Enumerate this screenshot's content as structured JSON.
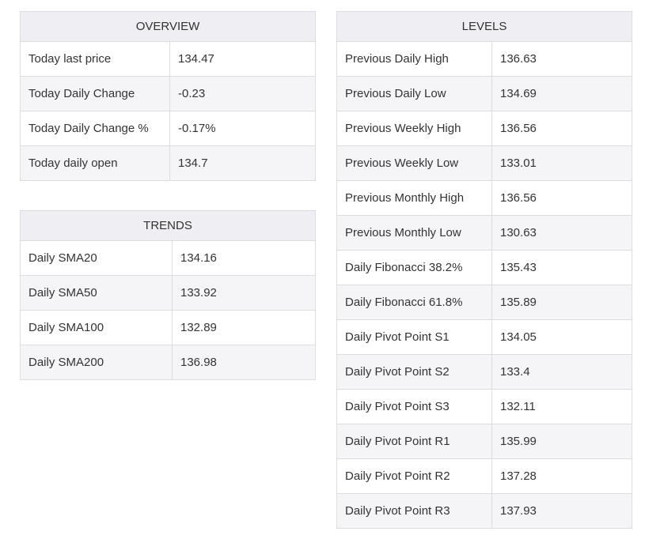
{
  "overview": {
    "title": "OVERVIEW",
    "rows": [
      {
        "label": "Today last price",
        "value": "134.47"
      },
      {
        "label": "Today Daily Change",
        "value": "-0.23"
      },
      {
        "label": "Today Daily Change %",
        "value": "-0.17%"
      },
      {
        "label": "Today daily open",
        "value": "134.7"
      }
    ]
  },
  "trends": {
    "title": "TRENDS",
    "rows": [
      {
        "label": "Daily SMA20",
        "value": "134.16"
      },
      {
        "label": "Daily SMA50",
        "value": "133.92"
      },
      {
        "label": "Daily SMA100",
        "value": "132.89"
      },
      {
        "label": "Daily SMA200",
        "value": "136.98"
      }
    ]
  },
  "levels": {
    "title": "LEVELS",
    "rows": [
      {
        "label": "Previous Daily High",
        "value": "136.63"
      },
      {
        "label": "Previous Daily Low",
        "value": "134.69"
      },
      {
        "label": "Previous Weekly High",
        "value": "136.56"
      },
      {
        "label": "Previous Weekly Low",
        "value": "133.01"
      },
      {
        "label": "Previous Monthly High",
        "value": "136.56"
      },
      {
        "label": "Previous Monthly Low",
        "value": "130.63"
      },
      {
        "label": "Daily Fibonacci 38.2%",
        "value": "135.43"
      },
      {
        "label": "Daily Fibonacci 61.8%",
        "value": "135.89"
      },
      {
        "label": "Daily Pivot Point S1",
        "value": "134.05"
      },
      {
        "label": "Daily Pivot Point S2",
        "value": "133.4"
      },
      {
        "label": "Daily Pivot Point S3",
        "value": "132.11"
      },
      {
        "label": "Daily Pivot Point R1",
        "value": "135.99"
      },
      {
        "label": "Daily Pivot Point R2",
        "value": "137.28"
      },
      {
        "label": "Daily Pivot Point R3",
        "value": "137.93"
      }
    ]
  }
}
